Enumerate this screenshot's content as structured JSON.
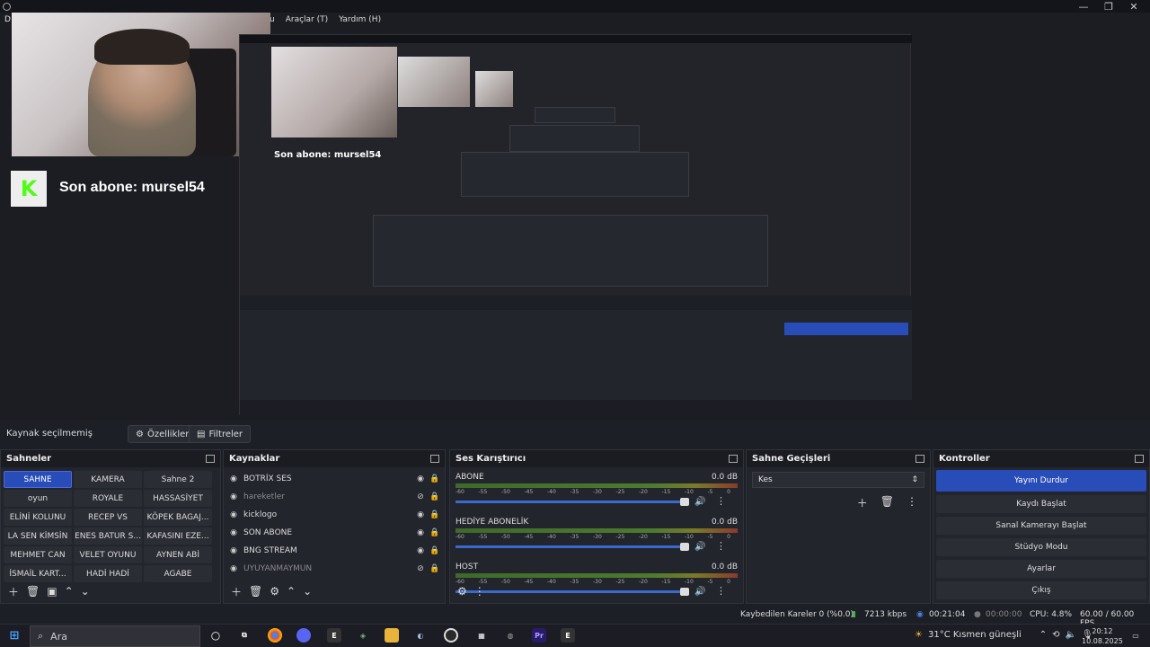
{
  "menu": {
    "items": [
      "u",
      "Araçlar (T)",
      "Yardım (H)"
    ],
    "left_label": "D"
  },
  "overlay": {
    "subscriber_text": "Son abone: mursel54",
    "mirror_subscriber_text": "Son abone: mursel54"
  },
  "source_status": {
    "label": "Kaynak seçilmemiş",
    "properties_label": "Özellikler",
    "filters_label": "Filtreler"
  },
  "scenes": {
    "title": "Sahneler",
    "items": [
      "SAHNE",
      "KAMERA",
      "Sahne 2",
      "oyun",
      "ROYALE",
      "HASSASİYET",
      "ELİNİ KOLUNU",
      "RECEP VS",
      "KÖPEK BAGAJ...",
      "LA SEN KİMSİN",
      "ENES BATUR S...",
      "KAFASINI EZE...",
      "MEHMET CAN",
      "VELET OYUNU",
      "AYNEN ABİ",
      "İSMAİL KART...",
      "HADİ HADİ",
      "AGABE"
    ],
    "active_index": 0
  },
  "sources": {
    "title": "Kaynaklar",
    "items": [
      {
        "name": "BOTRİX SES",
        "dim": false
      },
      {
        "name": "hareketler",
        "dim": true
      },
      {
        "name": "kicklogo",
        "dim": false
      },
      {
        "name": "SON ABONE",
        "dim": false
      },
      {
        "name": "BNG STREAM",
        "dim": false
      },
      {
        "name": "UYUYANMAYMUN",
        "dim": true
      }
    ]
  },
  "mixer": {
    "title": "Ses Karıştırıcı",
    "channels": [
      {
        "name": "ABONE",
        "db": "0.0 dB"
      },
      {
        "name": "HEDİYE ABONELİK",
        "db": "0.0 dB"
      },
      {
        "name": "HOST",
        "db": "0.0 dB"
      }
    ],
    "ticks": [
      "-60",
      "-55",
      "-50",
      "-45",
      "-40",
      "-35",
      "-30",
      "-25",
      "-20",
      "-15",
      "-10",
      "-5",
      "0"
    ]
  },
  "transitions": {
    "title": "Sahne Geçişleri",
    "selected": "Kes"
  },
  "controls": {
    "title": "Kontroller",
    "stop_stream": "Yayını Durdur",
    "start_record": "Kaydı Başlat",
    "virtual_cam": "Sanal Kamerayı Başlat",
    "studio_mode": "Stüdyo Modu",
    "settings": "Ayarlar",
    "exit": "Çıkış"
  },
  "statusbar": {
    "dropped": "Kaybedilen Kareler 0 (%0.0)",
    "bitrate": "7213 kbps",
    "live_time": "00:21:04",
    "rec_time": "00:00:00",
    "cpu": "CPU: 4.8%",
    "fps": "60.00 / 60.00 FPS"
  },
  "taskbar": {
    "search_placeholder": "Ara",
    "weather": "31°C  Kısmen güneşli",
    "time": "20:12",
    "date": "10.08.2025"
  },
  "colors": {
    "accent": "#284cb8",
    "kick": "#53fc18"
  }
}
